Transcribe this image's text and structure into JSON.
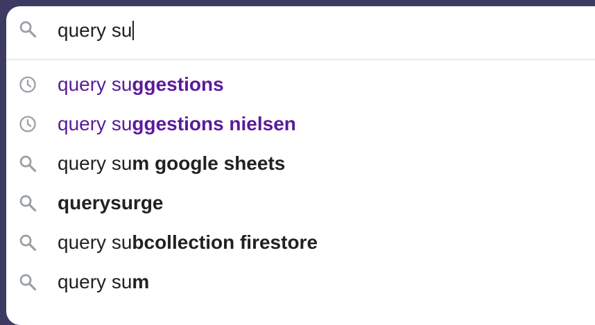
{
  "search": {
    "icon": "search-icon",
    "query": "query su"
  },
  "suggestions": [
    {
      "icon": "history-icon",
      "type": "history",
      "prefix": "query su",
      "completion": "ggestions"
    },
    {
      "icon": "history-icon",
      "type": "history",
      "prefix": "query su",
      "completion": "ggestions nielsen"
    },
    {
      "icon": "search-icon",
      "type": "search",
      "prefix": "query su",
      "completion": "m google sheets"
    },
    {
      "icon": "search-icon",
      "type": "search",
      "prefix": "",
      "completion": "querysurge"
    },
    {
      "icon": "search-icon",
      "type": "search",
      "prefix": "query su",
      "completion": "bcollection firestore"
    },
    {
      "icon": "search-icon",
      "type": "search",
      "prefix": "query su",
      "completion": "m"
    }
  ],
  "colors": {
    "history_text": "#5a1a9a",
    "normal_text": "#202124",
    "icon": "#9aa0a6",
    "background": "#3d3b63"
  }
}
